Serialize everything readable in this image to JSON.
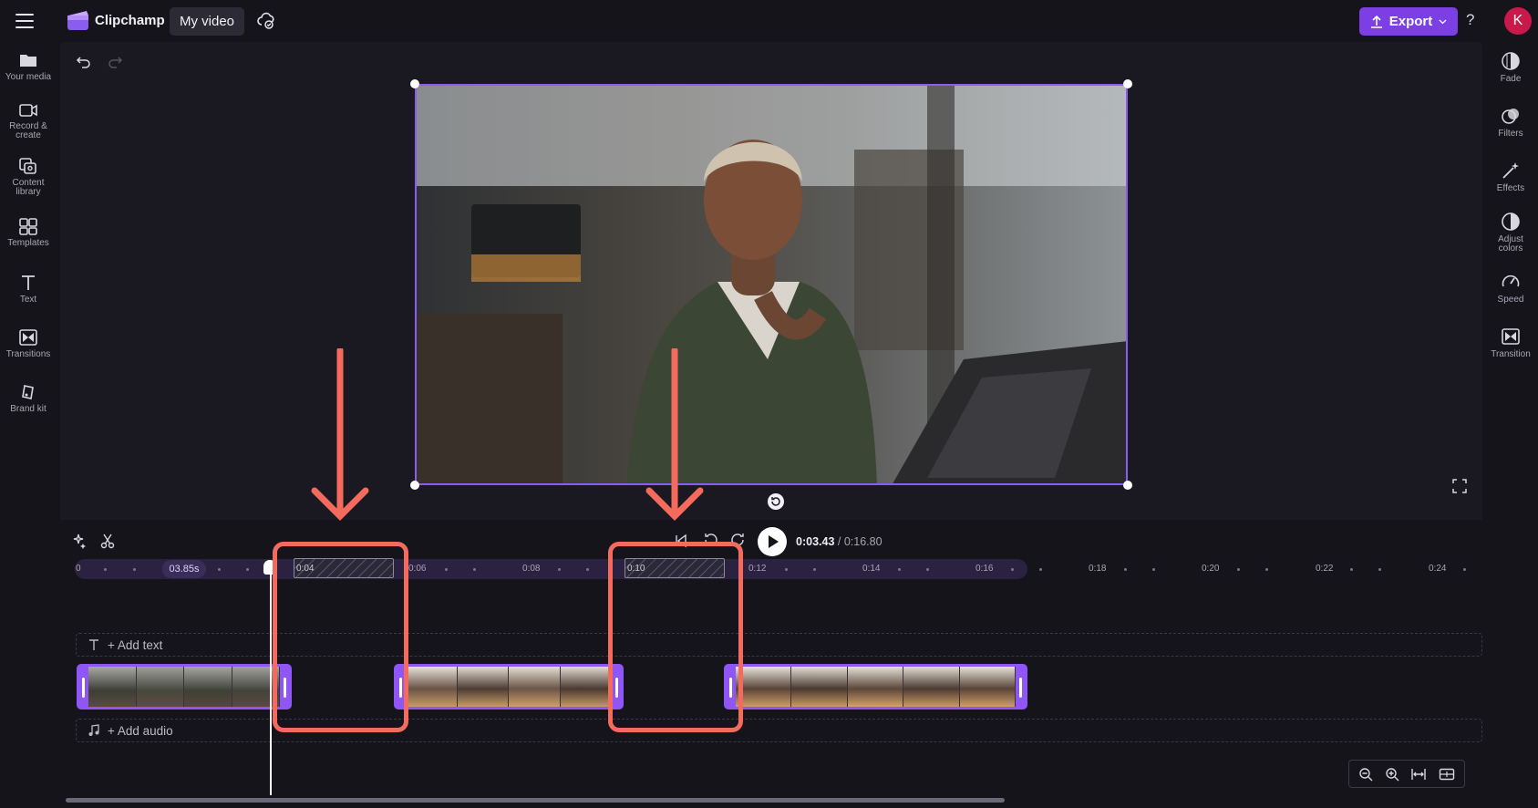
{
  "app": {
    "name": "Clipchamp",
    "project_title": "My video"
  },
  "header": {
    "export_label": "Export",
    "help_label": "?",
    "avatar_initial": "K"
  },
  "left_sidebar": {
    "items": [
      {
        "icon": "folder-icon",
        "label": "Your media"
      },
      {
        "icon": "camera-icon",
        "label": "Record & create"
      },
      {
        "icon": "content-library-icon",
        "label": "Content library"
      },
      {
        "icon": "templates-icon",
        "label": "Templates"
      },
      {
        "icon": "text-icon",
        "label": "Text"
      },
      {
        "icon": "transitions-icon",
        "label": "Transitions"
      },
      {
        "icon": "brand-kit-icon",
        "label": "Brand kit"
      }
    ]
  },
  "right_sidebar": {
    "items": [
      {
        "icon": "fade-icon",
        "label": "Fade"
      },
      {
        "icon": "filters-icon",
        "label": "Filters"
      },
      {
        "icon": "effects-icon",
        "label": "Effects"
      },
      {
        "icon": "adjust-colors-icon",
        "label": "Adjust colors"
      },
      {
        "icon": "speed-icon",
        "label": "Speed"
      },
      {
        "icon": "transition-icon",
        "label": "Transition"
      }
    ]
  },
  "playback": {
    "current_time": "0:03.43",
    "total_time": "0:16.80"
  },
  "timeline": {
    "playhead_badge": "03.85s",
    "ruler_labels": [
      "0",
      "0:04",
      "0:06",
      "0:08",
      "0:10",
      "0:12",
      "0:14",
      "0:16",
      "0:18",
      "0:20",
      "0:22",
      "0:24"
    ],
    "add_text_label": "+ Add text",
    "add_audio_label": "+ Add audio"
  },
  "colors": {
    "accent": "#7b3fe4",
    "clip_border": "#8f55f5",
    "annotation": "#f46b5e",
    "avatar": "#c9184a"
  }
}
